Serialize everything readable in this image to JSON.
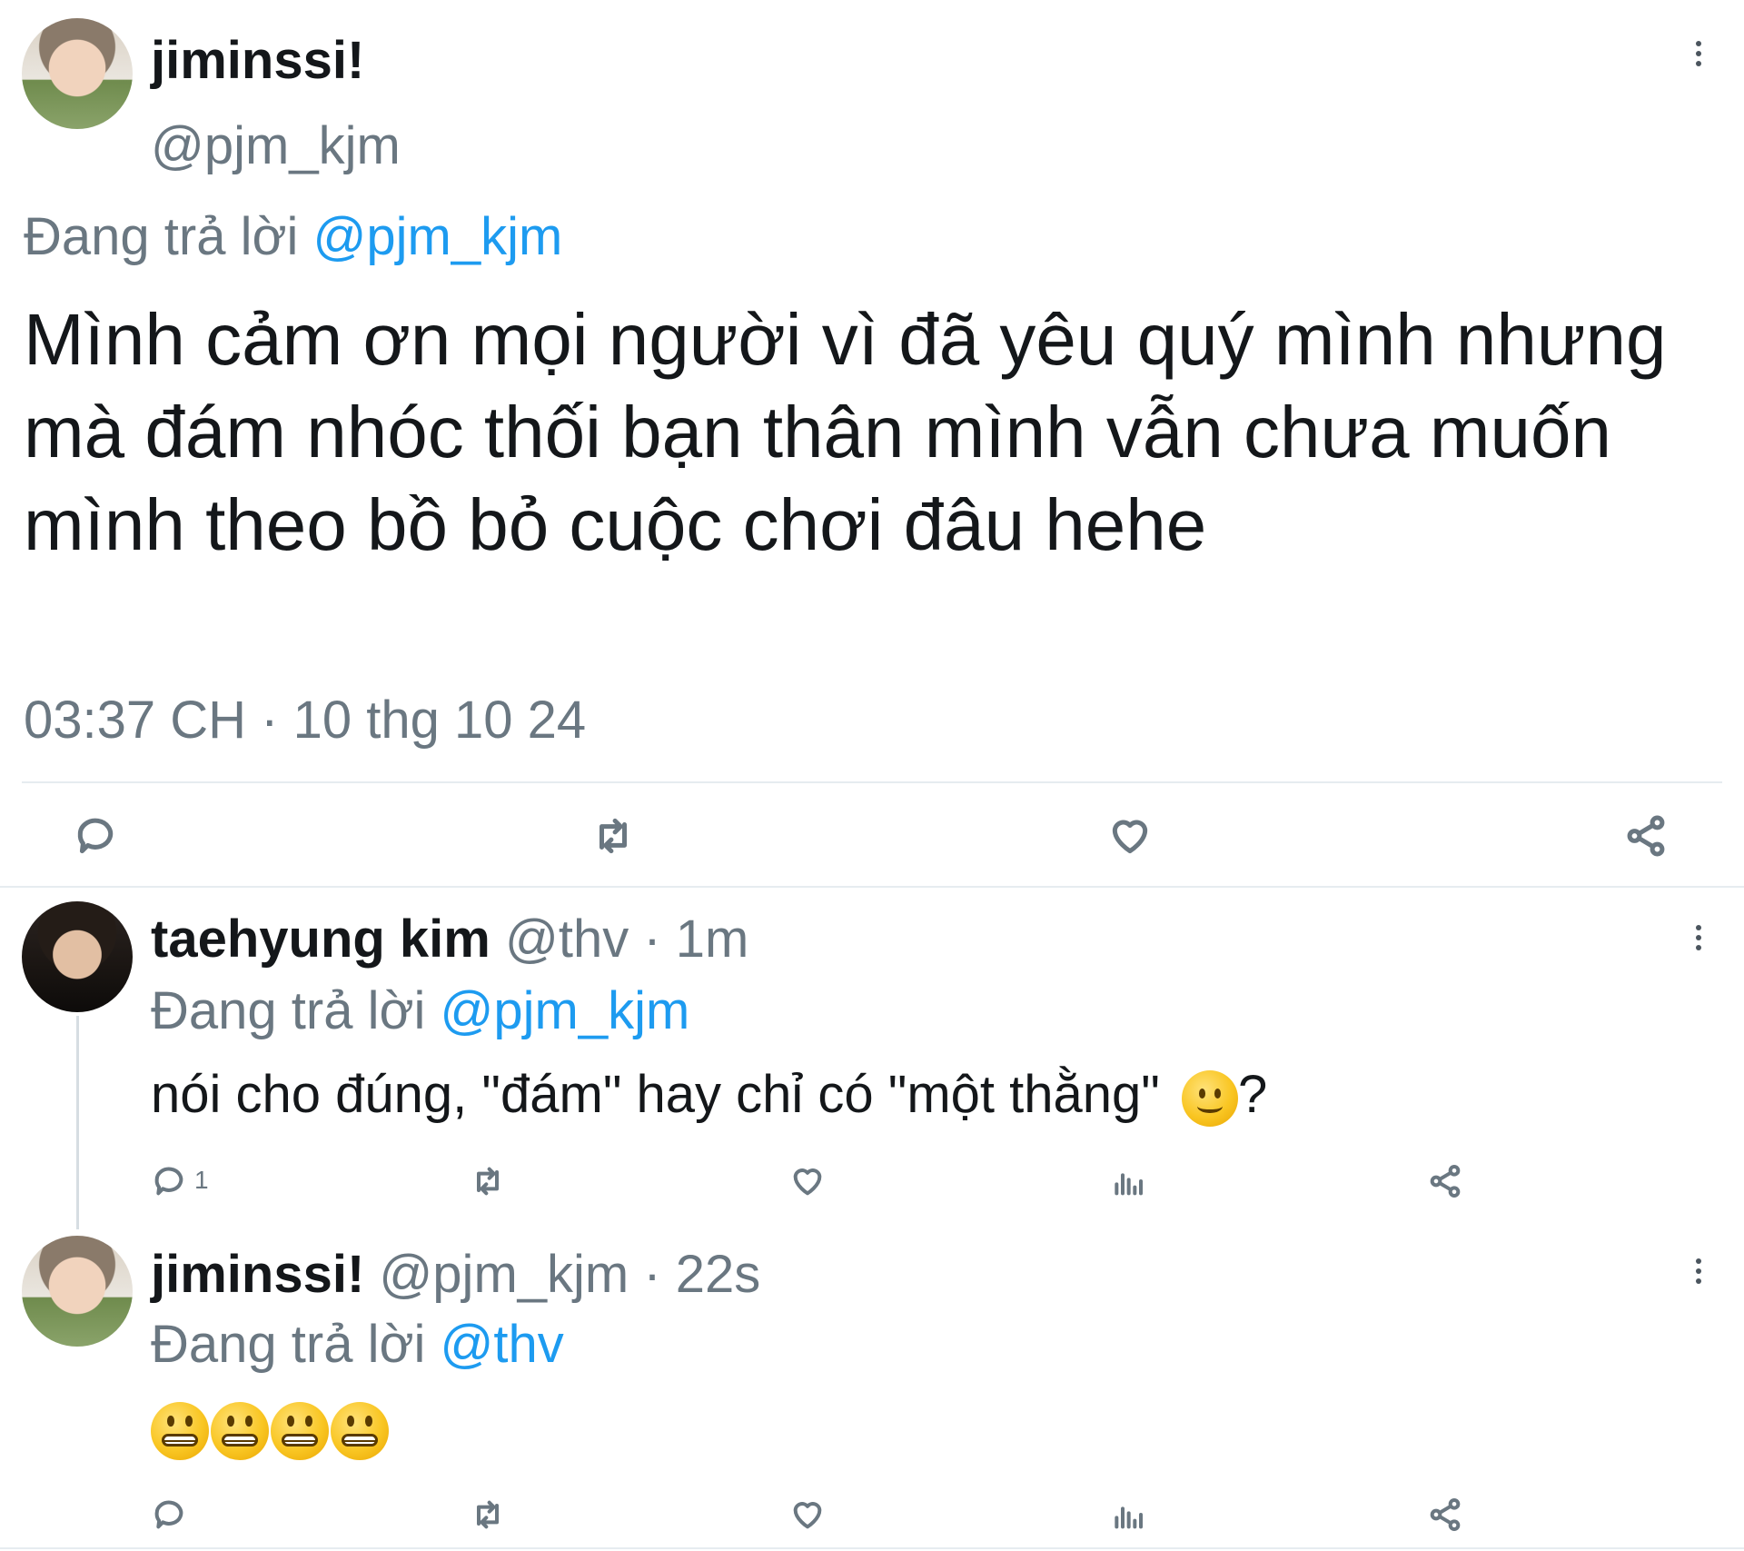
{
  "main_tweet": {
    "display_name": "jiminssi!",
    "handle": "@pjm_kjm",
    "replying_prefix": "Đang trả lời",
    "replying_to": "@pjm_kjm",
    "text": "Mình cảm ơn mọi người vì đã yêu quý mình nhưng mà đám nhóc thối bạn thân mình vẫn chưa muốn mình theo bồ bỏ cuộc chơi đâu hehe",
    "timestamp": "03:37 CH · 10 thg 10 24",
    "actions": [
      "reply-icon",
      "retweet-icon",
      "like-icon",
      "share-icon"
    ]
  },
  "reply_1": {
    "display_name": "taehyung kim",
    "handle": "@thv",
    "time": "· 1m",
    "replying_prefix": "Đang trả lời",
    "replying_to": "@pjm_kjm",
    "text": "nói cho đúng, \"đám\" hay chỉ có \"một thằng\"",
    "text_suffix": "?",
    "emoji": "slightly-smiling-face",
    "reply_count": "1",
    "actions": [
      "reply-icon",
      "retweet-icon",
      "like-icon",
      "views-icon",
      "share-icon"
    ]
  },
  "reply_2": {
    "display_name": "jiminssi!",
    "handle": "@pjm_kjm",
    "time": "· 22s",
    "replying_prefix": "Đang trả lời",
    "replying_to": "@thv",
    "emoji": "grimacing-face",
    "emoji_count": 4,
    "actions": [
      "reply-icon",
      "retweet-icon",
      "like-icon",
      "views-icon",
      "share-icon"
    ]
  },
  "colors": {
    "text": "#14171a",
    "secondary": "#6a7781",
    "link": "#1d9bf0",
    "divider": "#e6ecf0"
  }
}
